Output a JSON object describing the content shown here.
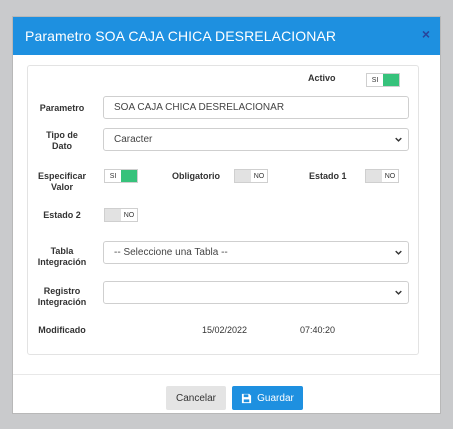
{
  "modal": {
    "title": "Parametro SOA CAJA CHICA DESRELACIONAR",
    "close_glyph": "×"
  },
  "form": {
    "activo": {
      "label": "Activo",
      "state": "SI"
    },
    "parametro": {
      "label": "Parametro",
      "value": "SOA CAJA CHICA DESRELACIONAR"
    },
    "tipo_dato": {
      "label_line1": "Tipo de",
      "label_line2": "Dato",
      "value": "Caracter"
    },
    "especificar_valor": {
      "label_line1": "Especificar",
      "label_line2": "Valor",
      "state": "SI"
    },
    "obligatorio": {
      "label": "Obligatorio",
      "state": "NO"
    },
    "estado1": {
      "label": "Estado 1",
      "state": "NO"
    },
    "estado2": {
      "label": "Estado 2",
      "state": "NO"
    },
    "tabla_integracion": {
      "label_line1": "Tabla",
      "label_line2": "Integración",
      "value": "-- Seleccione una Tabla --"
    },
    "registro_integracion": {
      "label_line1": "Registro",
      "label_line2": "Integración",
      "value": ""
    },
    "modificado": {
      "label": "Modificado",
      "date": "15/02/2022",
      "time": "07:40:20"
    }
  },
  "footer": {
    "cancel_label": "Cancelar",
    "save_label": "Guardar",
    "save_icon": "save-icon"
  },
  "colors": {
    "header": "#1e90e0",
    "toggle_on": "#36c27b",
    "toggle_off": "#e2e2e2",
    "overlay": "#c9cacc"
  }
}
